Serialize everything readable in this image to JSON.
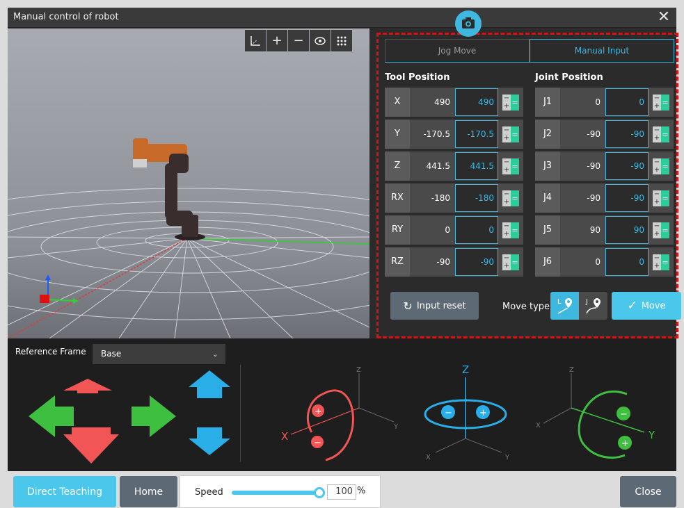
{
  "window": {
    "title": "Manual control of robot"
  },
  "tabs": {
    "jog": "Jog Move",
    "manual": "Manual Input"
  },
  "tool_position": {
    "title": "Tool Position",
    "rows": [
      {
        "label": "X",
        "current": "490",
        "input": "490"
      },
      {
        "label": "Y",
        "current": "-170.5",
        "input": "-170.5"
      },
      {
        "label": "Z",
        "current": "441.5",
        "input": "441.5"
      },
      {
        "label": "RX",
        "current": "-180",
        "input": "-180"
      },
      {
        "label": "RY",
        "current": "0",
        "input": "0"
      },
      {
        "label": "RZ",
        "current": "-90",
        "input": "-90"
      }
    ]
  },
  "joint_position": {
    "title": "Joint Position",
    "rows": [
      {
        "label": "J1",
        "current": "0",
        "input": "0"
      },
      {
        "label": "J2",
        "current": "-90",
        "input": "-90"
      },
      {
        "label": "J3",
        "current": "-90",
        "input": "-90"
      },
      {
        "label": "J4",
        "current": "-90",
        "input": "-90"
      },
      {
        "label": "J5",
        "current": "90",
        "input": "90"
      },
      {
        "label": "J6",
        "current": "0",
        "input": "0"
      }
    ]
  },
  "actions": {
    "reset": "Input reset",
    "move_type": "Move type",
    "move_type_linear": "L",
    "move_type_joint": "J",
    "move": "Move"
  },
  "jog": {
    "reference_label": "Reference Frame",
    "reference_value": "Base",
    "rx_axis": "X",
    "rz_axis": "Z",
    "ry_axis": "Y",
    "small_x": "X",
    "small_y": "Y",
    "small_z": "Z",
    "plus": "+",
    "minus": "−"
  },
  "bottom": {
    "direct_teaching": "Direct Teaching",
    "home": "Home",
    "speed_label": "Speed",
    "speed_value": "100",
    "speed_unit": "%",
    "close": "Close"
  },
  "colors": {
    "accent": "#3fb8e0",
    "red": "#f25555",
    "green": "#3fbf3f",
    "blue": "#2aaee8"
  }
}
